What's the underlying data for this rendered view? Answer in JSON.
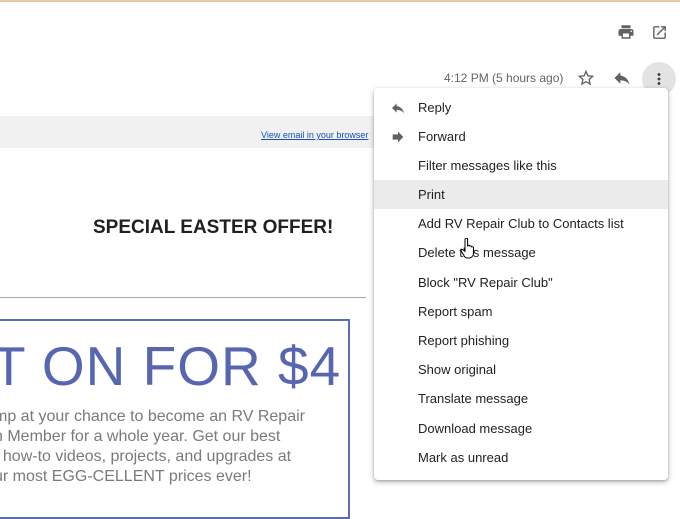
{
  "toolbar": {
    "print_icon": "printer-icon",
    "open_new_window_icon": "open-in-new-icon"
  },
  "message_header": {
    "timestamp": "4:12 PM (5 hours ago)",
    "star_icon": "star-outline-icon",
    "reply_icon": "reply-icon",
    "more_icon": "more-vertical-icon"
  },
  "email_body": {
    "view_in_browser": "View email in your browser",
    "headline": "SPECIAL EASTER OFFER!",
    "promo_big": "T ON FOR $4",
    "promo_text": "mp at your chance to become an RV Repair\nn Member for a whole year. Get our best\n/ how-to videos, projects, and upgrades at\nur most EGG-CELLENT prices ever!"
  },
  "menu": {
    "items": [
      {
        "label": "Reply",
        "icon": "reply-icon"
      },
      {
        "label": "Forward",
        "icon": "forward-icon"
      },
      {
        "label": "Filter messages like this",
        "icon": ""
      },
      {
        "label": "Print",
        "icon": ""
      },
      {
        "label": "Add RV Repair Club to Contacts list",
        "icon": ""
      },
      {
        "label": "Delete this message",
        "icon": ""
      },
      {
        "label": "Block \"RV Repair Club\"",
        "icon": ""
      },
      {
        "label": "Report spam",
        "icon": ""
      },
      {
        "label": "Report phishing",
        "icon": ""
      },
      {
        "label": "Show original",
        "icon": ""
      },
      {
        "label": "Translate message",
        "icon": ""
      },
      {
        "label": "Download message",
        "icon": ""
      },
      {
        "label": "Mark as unread",
        "icon": ""
      }
    ],
    "highlighted": "Print"
  },
  "colors": {
    "promo_accent": "#5866b0",
    "link": "#1a4fb8",
    "menu_hover": "#ebebeb"
  }
}
